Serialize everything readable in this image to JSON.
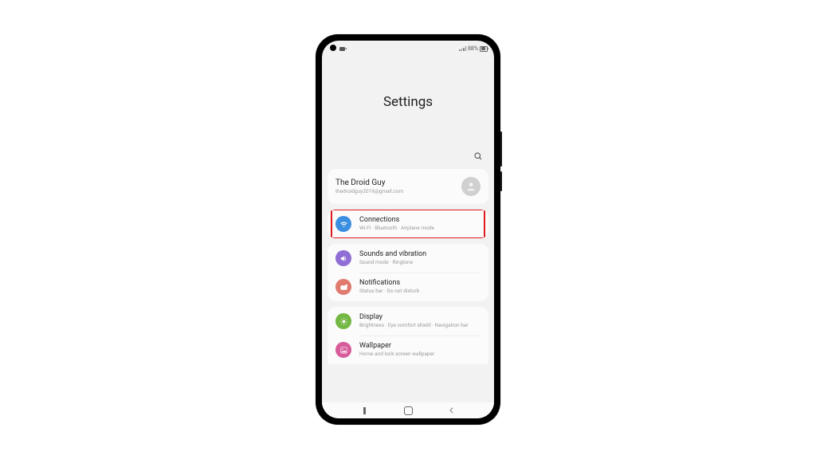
{
  "status": {
    "battery_pct": "88%"
  },
  "header": {
    "title": "Settings"
  },
  "account": {
    "name": "The Droid Guy",
    "email": "thedroidguy2019@gmail.com"
  },
  "groups": [
    {
      "items": [
        {
          "id": "connections",
          "title": "Connections",
          "subtitle": "Wi-Fi · Bluetooth · Airplane mode",
          "icon": "wifi-icon",
          "color": "#3a8fe0",
          "highlighted": true
        }
      ]
    },
    {
      "items": [
        {
          "id": "sounds",
          "title": "Sounds and vibration",
          "subtitle": "Sound mode · Ringtone",
          "icon": "sound-icon",
          "color": "#8f6ed5"
        },
        {
          "id": "notifications",
          "title": "Notifications",
          "subtitle": "Status bar · Do not disturb",
          "icon": "notifications-icon",
          "color": "#e07a6e"
        }
      ]
    },
    {
      "items": [
        {
          "id": "display",
          "title": "Display",
          "subtitle": "Brightness · Eye comfort shield · Navigation bar",
          "icon": "display-icon",
          "color": "#73b843"
        },
        {
          "id": "wallpaper",
          "title": "Wallpaper",
          "subtitle": "Home and lock screen wallpaper",
          "icon": "wallpaper-icon",
          "color": "#d85b9a"
        }
      ]
    }
  ]
}
